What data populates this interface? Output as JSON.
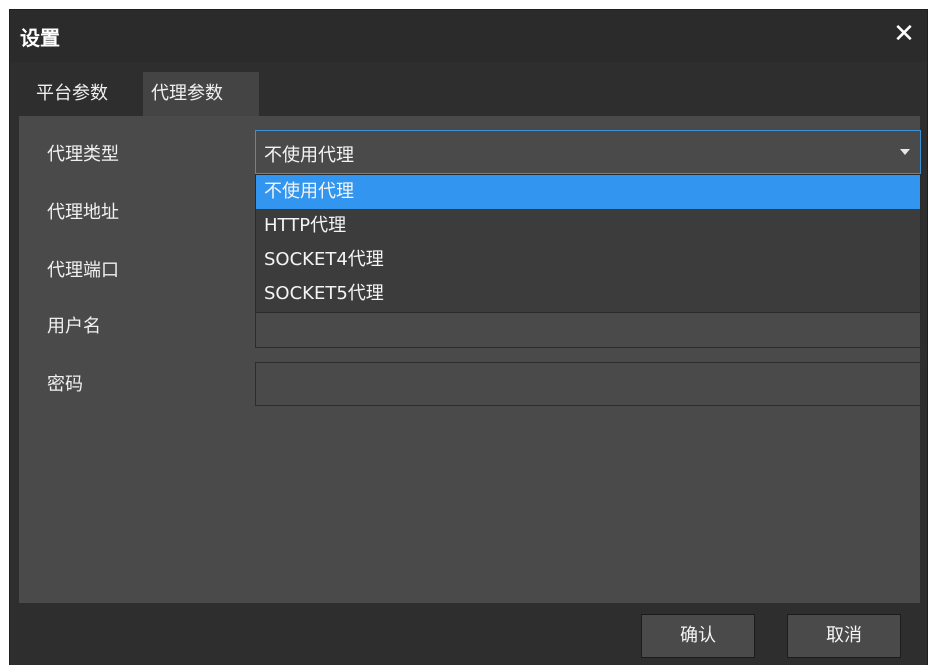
{
  "dialog": {
    "title": "设置",
    "close_icon": "close-icon"
  },
  "tabs": [
    {
      "label": "平台参数",
      "active": false
    },
    {
      "label": "代理参数",
      "active": true
    }
  ],
  "form": {
    "proxy_type_label": "代理类型",
    "proxy_address_label": "代理地址",
    "proxy_port_label": "代理端口",
    "username_label": "用户名",
    "password_label": "密码",
    "proxy_type_value": "不使用代理",
    "username_value": "",
    "password_value": ""
  },
  "dropdown": {
    "options": [
      "不使用代理",
      "HTTP代理",
      "SOCKET4代理",
      "SOCKET5代理"
    ],
    "selected_index": 0
  },
  "footer": {
    "ok_label": "确认",
    "cancel_label": "取消"
  },
  "colors": {
    "accent": "#3296f0",
    "dialog_bg": "#2e2e2e",
    "panel_bg": "#4a4a4a"
  }
}
